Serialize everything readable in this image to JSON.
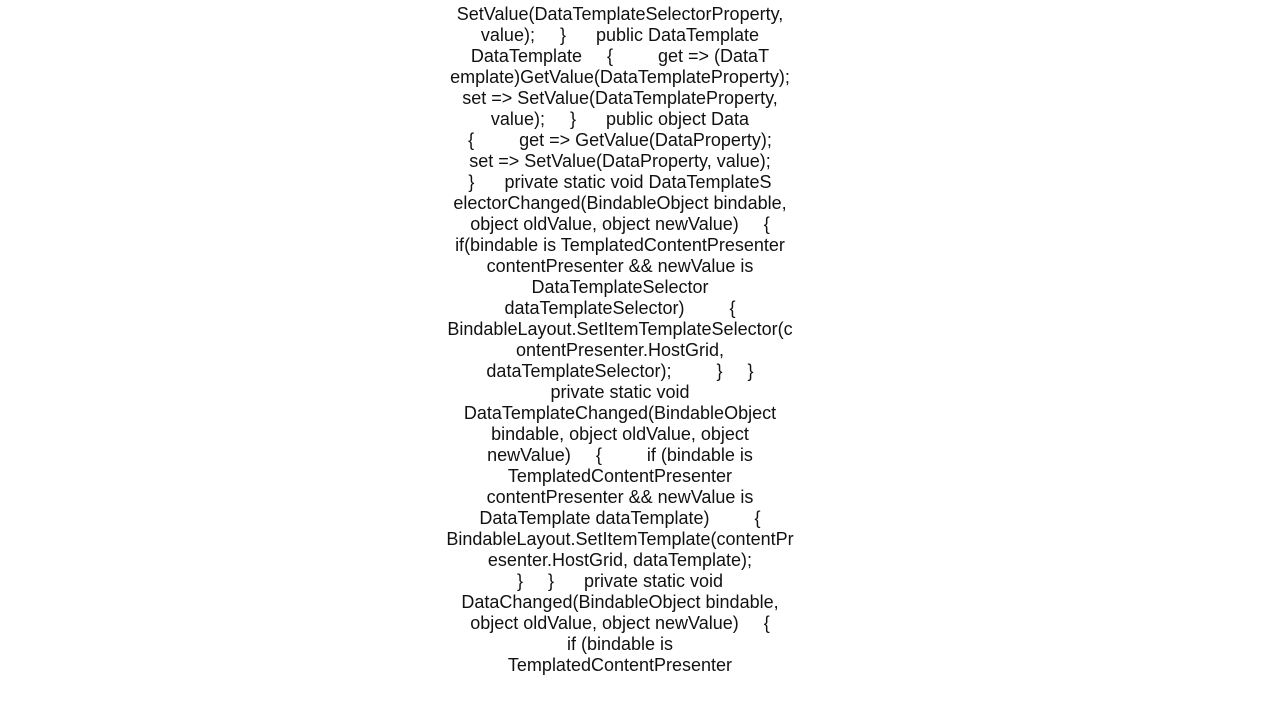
{
  "lines": [
    "SetValue(DataTemplateSelectorProperty,",
    "value);     }      public DataTemplate",
    "DataTemplate     {         get => (DataT",
    "emplate)GetValue(DataTemplateProperty);",
    "set => SetValue(DataTemplateProperty,",
    "value);     }      public object Data",
    "{         get => GetValue(DataProperty);",
    "set => SetValue(DataProperty, value);",
    "}      private static void DataTemplateS",
    "electorChanged(BindableObject bindable,",
    "object oldValue, object newValue)     {",
    "if(bindable is TemplatedContentPresenter",
    "contentPresenter && newValue is",
    "DataTemplateSelector",
    "dataTemplateSelector)         {",
    "BindableLayout.SetItemTemplateSelector(c",
    "ontentPresenter.HostGrid,",
    "dataTemplateSelector);         }     }",
    "private static void",
    "DataTemplateChanged(BindableObject",
    "bindable, object oldValue, object",
    "newValue)     {         if (bindable is",
    "TemplatedContentPresenter",
    "contentPresenter && newValue is",
    "DataTemplate dataTemplate)         {",
    "BindableLayout.SetItemTemplate(contentPr",
    "esenter.HostGrid, dataTemplate);",
    "}     }      private static void",
    "DataChanged(BindableObject bindable,",
    "object oldValue, object newValue)     {",
    "if (bindable is",
    "TemplatedContentPresenter"
  ]
}
